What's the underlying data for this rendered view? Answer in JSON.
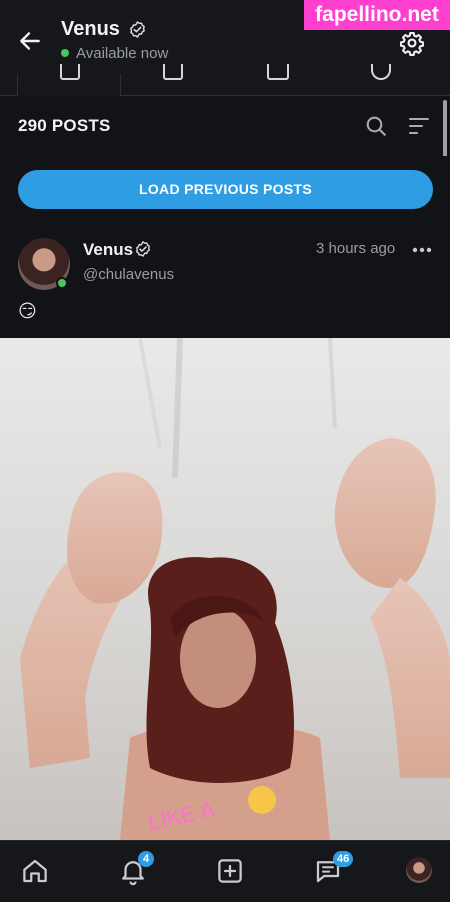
{
  "header": {
    "title": "Venus",
    "status": "Available now"
  },
  "watermark": "fapellino.net",
  "tabs": [
    {
      "icon": "posts-icon",
      "active": true
    },
    {
      "icon": "media-icon",
      "active": false
    },
    {
      "icon": "video-icon",
      "active": false
    },
    {
      "icon": "clock-icon",
      "active": false
    }
  ],
  "feed": {
    "post_count": "290 POSTS",
    "load_button": "LOAD PREVIOUS POSTS"
  },
  "post": {
    "author": "Venus",
    "handle": "@chulavenus",
    "time": "3 hours ago",
    "text": "😏",
    "media_overlay_text": "LIKE A"
  },
  "nav": {
    "notifications_badge": "4",
    "messages_badge": "46"
  },
  "colors": {
    "accent": "#2f9de4",
    "online": "#4fc35c",
    "background": "#121316"
  }
}
